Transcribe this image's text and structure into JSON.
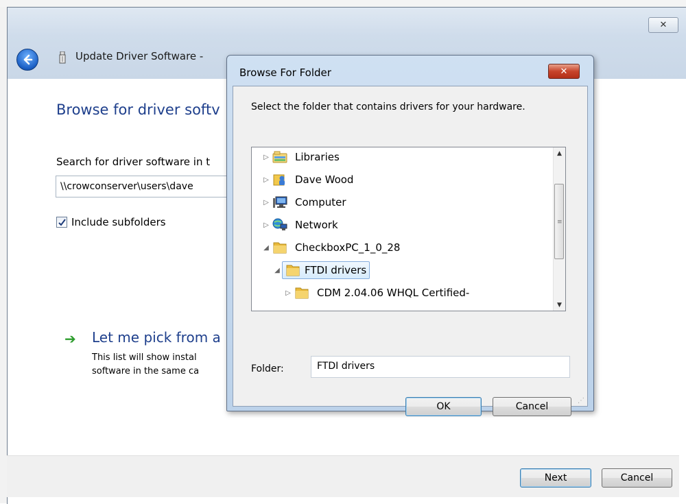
{
  "main_window": {
    "title": "Update Driver Software - ",
    "heading": "Browse for driver softv",
    "search_label": "Search for driver software in t",
    "path_value": "\\\\crowconserver\\users\\dave",
    "include_subfolders_label": "Include subfolders",
    "include_subfolders_checked": true,
    "pick_link": "Let me pick from a",
    "pick_desc_line1": "This list will show instal",
    "pick_desc_line2": "software in the same ca",
    "close_glyph": "✕",
    "next_label": "Next",
    "cancel_label": "Cancel"
  },
  "dialog": {
    "title": "Browse For Folder",
    "instruction": "Select the folder that contains drivers for your hardware.",
    "tree": [
      {
        "label": "Libraries",
        "icon": "libraries-icon",
        "expander": "collapsed",
        "indent": 0
      },
      {
        "label": "Dave Wood",
        "icon": "user-folder-icon",
        "expander": "collapsed",
        "indent": 0
      },
      {
        "label": "Computer",
        "icon": "computer-icon",
        "expander": "collapsed",
        "indent": 0
      },
      {
        "label": "Network",
        "icon": "network-icon",
        "expander": "collapsed",
        "indent": 0
      },
      {
        "label": "CheckboxPC_1_0_28",
        "icon": "folder-icon",
        "expander": "expanded",
        "indent": 0
      },
      {
        "label": "FTDI drivers",
        "icon": "folder-icon",
        "expander": "expanded",
        "indent": 1,
        "selected": true
      },
      {
        "label": "CDM 2.04.06 WHQL Certified-",
        "icon": "folder-icon",
        "expander": "collapsed",
        "indent": 2
      }
    ],
    "folder_label": "Folder:",
    "folder_value": "FTDI drivers",
    "ok_label": "OK",
    "cancel_label": "Cancel"
  },
  "colors": {
    "heading_blue": "#1e3f8c",
    "selection_border": "#84acdd",
    "close_red": "#c7442b"
  }
}
